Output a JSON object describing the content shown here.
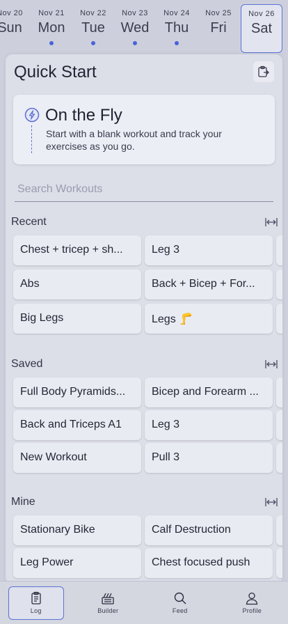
{
  "dates": [
    {
      "date": "Nov 20",
      "day": "Sun",
      "dot": false,
      "selected": false
    },
    {
      "date": "Nov 21",
      "day": "Mon",
      "dot": true,
      "selected": false
    },
    {
      "date": "Nov 22",
      "day": "Tue",
      "dot": true,
      "selected": false
    },
    {
      "date": "Nov 23",
      "day": "Wed",
      "dot": true,
      "selected": false
    },
    {
      "date": "Nov 24",
      "day": "Thu",
      "dot": true,
      "selected": false
    },
    {
      "date": "Nov 25",
      "day": "Fri",
      "dot": false,
      "selected": false
    },
    {
      "date": "Nov 26",
      "day": "Sat",
      "dot": false,
      "selected": true
    }
  ],
  "quick_start": {
    "title": "Quick Start",
    "fly_title": "On the Fly",
    "fly_desc": "Start with a blank workout and track your exercises as you go.",
    "search_placeholder": "Search Workouts"
  },
  "sections": {
    "recent": {
      "label": "Recent",
      "items": [
        "Chest + tricep + sh...",
        "Leg 3",
        "Abs",
        "Back + Bicep + For...",
        "Big Legs",
        "Legs 🦵"
      ]
    },
    "saved": {
      "label": "Saved",
      "items": [
        "Full Body Pyramids...",
        "Bicep and Forearm ...",
        "Back and Triceps A1",
        "Leg 3",
        "New Workout",
        "Pull 3"
      ]
    },
    "mine": {
      "label": "Mine",
      "items": [
        "Stationary Bike",
        "Calf Destruction",
        "Leg Power",
        "Chest focused push"
      ]
    }
  },
  "nav": {
    "log": "Log",
    "builder": "Builder",
    "feed": "Feed",
    "profile": "Profile"
  },
  "colors": {
    "accent": "#4a63d9"
  }
}
